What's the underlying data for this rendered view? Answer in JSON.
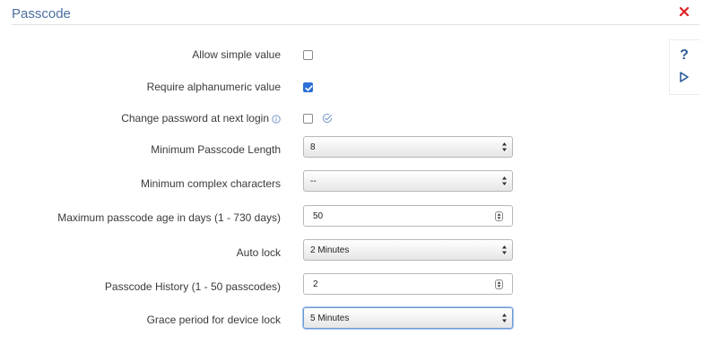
{
  "header": {
    "title": "Passcode"
  },
  "side_tools": {
    "help_label": "?"
  },
  "fields": {
    "allow_simple": {
      "label": "Allow simple value",
      "checked": false
    },
    "require_alnum": {
      "label": "Require alphanumeric value",
      "checked": true
    },
    "change_password": {
      "label": "Change password at next login",
      "checked": false
    },
    "min_length": {
      "label": "Minimum Passcode Length",
      "value": "8"
    },
    "min_complex": {
      "label": "Minimum complex characters",
      "value": "--"
    },
    "max_age": {
      "label": "Maximum passcode age in days (1 - 730 days)",
      "value": "50"
    },
    "auto_lock": {
      "label": "Auto lock",
      "value": "2 Minutes"
    },
    "history": {
      "label": "Passcode History (1 - 50 passcodes)",
      "value": "2"
    },
    "grace_period": {
      "label": "Grace period for device lock",
      "value": "5 Minutes"
    }
  },
  "colors": {
    "accent": "#4a6fa0",
    "checkbox_checked": "#2d6fd6",
    "close": "#e02020"
  }
}
